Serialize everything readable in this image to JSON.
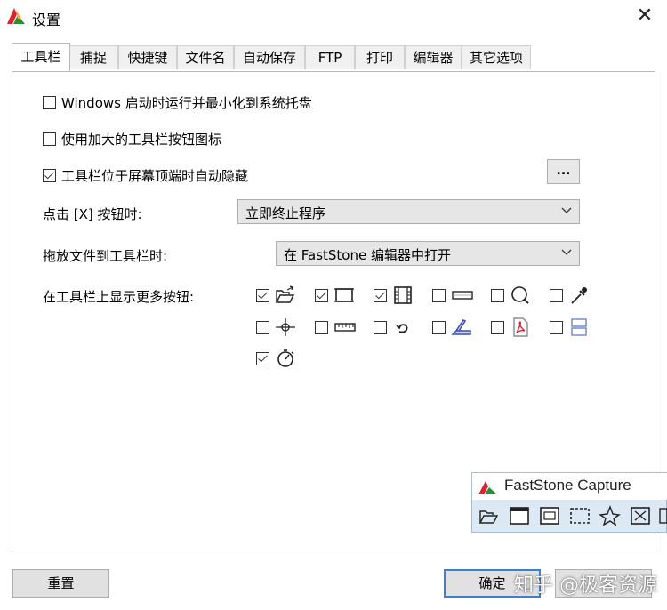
{
  "window": {
    "title": "设置",
    "close_glyph": "✕"
  },
  "tabs": [
    {
      "label": "工具栏",
      "active": true
    },
    {
      "label": "捕捉",
      "active": false
    },
    {
      "label": "快捷键",
      "active": false
    },
    {
      "label": "文件名",
      "active": false
    },
    {
      "label": "自动保存",
      "active": false
    },
    {
      "label": "FTP",
      "active": false
    },
    {
      "label": "打印",
      "active": false
    },
    {
      "label": "编辑器",
      "active": false
    },
    {
      "label": "其它选项",
      "active": false
    }
  ],
  "options": {
    "minimize_tray": {
      "label": "Windows 启动时运行并最小化到系统托盘",
      "checked": false
    },
    "large_icons": {
      "label": "使用加大的工具栏按钮图标",
      "checked": false
    },
    "auto_hide": {
      "label": "工具栏位于屏幕顶端时自动隐藏",
      "checked": true
    },
    "more_button_label": "..."
  },
  "close_action": {
    "label": "点击 [X] 按钮时:",
    "value": "立即终止程序"
  },
  "drop_action": {
    "label": "拖放文件到工具栏时:",
    "value": "在 FastStone 编辑器中打开"
  },
  "extra_buttons": {
    "label": "在工具栏上显示更多按钮:",
    "items": [
      {
        "icon": "open-file-icon",
        "checked": true
      },
      {
        "icon": "window-frame-icon",
        "checked": true
      },
      {
        "icon": "film-strip-icon",
        "checked": true
      },
      {
        "icon": "scroll-region-icon",
        "checked": false
      },
      {
        "icon": "magnifier-icon",
        "checked": false
      },
      {
        "icon": "color-picker-icon",
        "checked": false
      },
      {
        "icon": "crosshair-icon",
        "checked": false
      },
      {
        "icon": "ruler-icon",
        "checked": false
      },
      {
        "icon": "undo-arrow-icon",
        "checked": false
      },
      {
        "icon": "scanner-icon",
        "checked": false
      },
      {
        "icon": "pdf-icon",
        "checked": false
      },
      {
        "icon": "split-window-icon",
        "checked": false
      },
      {
        "icon": "timer-icon",
        "checked": true
      }
    ]
  },
  "faststone_bar": {
    "title": "FastStone Capture"
  },
  "buttons": {
    "reset": "重置",
    "ok": "确定"
  },
  "watermark": "知乎 @极客资源",
  "colors": {
    "accent_blue": "#3c7fd0",
    "logo_red": "#d9232e",
    "logo_green": "#2e8b3a"
  }
}
